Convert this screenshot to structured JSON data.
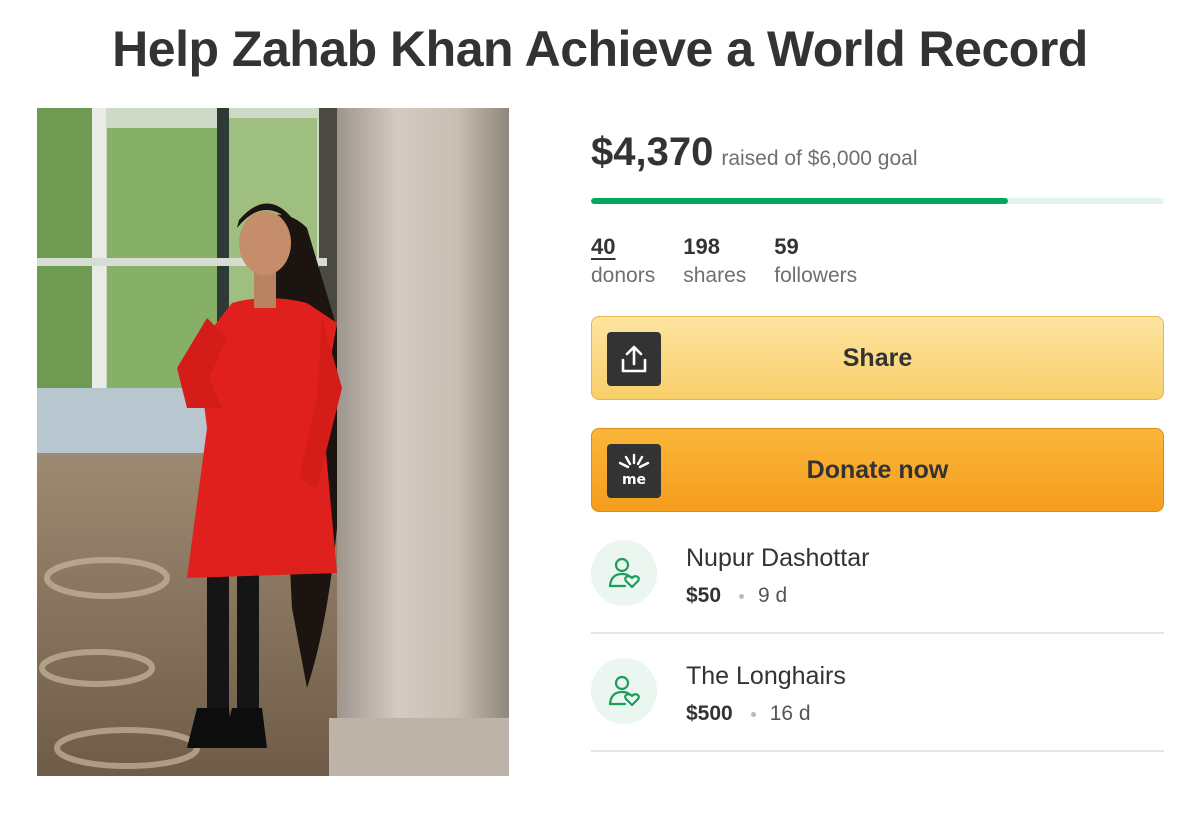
{
  "campaign": {
    "title": "Help Zahab Khan Achieve a World Record"
  },
  "fundraising": {
    "raised_amount": "$4,370",
    "raised_label": "raised of $6,000 goal",
    "progress_fraction": 0.728
  },
  "stats": [
    {
      "value": "40",
      "label": "donors"
    },
    {
      "value": "198",
      "label": "shares"
    },
    {
      "value": "59",
      "label": "followers"
    }
  ],
  "buttons": {
    "share_label": "Share",
    "donate_label": "Donate now",
    "donate_icon_text": "me"
  },
  "donations": [
    {
      "name": "Nupur Dashottar",
      "amount": "$50",
      "time": "9 d"
    },
    {
      "name": "The Longhairs",
      "amount": "$500",
      "time": "16 d"
    }
  ],
  "colors": {
    "progress": "#02a95c",
    "share_button": "#f9cf6a",
    "donate_button": "#f59d1c",
    "dress": "#e0201c"
  },
  "icons": {
    "share": "share-upload-icon",
    "donate": "gofundme-icon",
    "donor": "donor-heart-icon"
  }
}
